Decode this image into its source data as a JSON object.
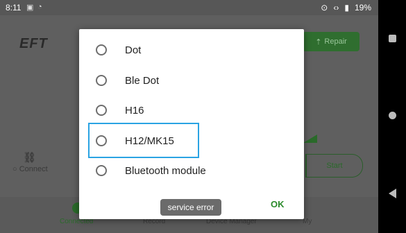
{
  "status_bar": {
    "time": "8:11",
    "battery": "19%"
  },
  "app": {
    "logo": "EFT",
    "repair_label": "Repair",
    "connect_label": "Connect",
    "start_label": "Start"
  },
  "tabs": [
    {
      "label": "Connected",
      "active": true
    },
    {
      "label": "Record",
      "active": false
    },
    {
      "label": "Device Manager",
      "active": false
    },
    {
      "label": "My",
      "active": false
    }
  ],
  "dialog": {
    "options": [
      {
        "label": "Dot",
        "selected": false
      },
      {
        "label": "Ble Dot",
        "selected": false
      },
      {
        "label": "H16",
        "selected": false
      },
      {
        "label": "H12/MK15",
        "selected": false
      },
      {
        "label": "Bluetooth module",
        "selected": false
      }
    ],
    "ok_label": "OK"
  },
  "toast": "service error",
  "colors": {
    "accent": "#2aa3e3",
    "brand_green": "#2a6a2a"
  }
}
